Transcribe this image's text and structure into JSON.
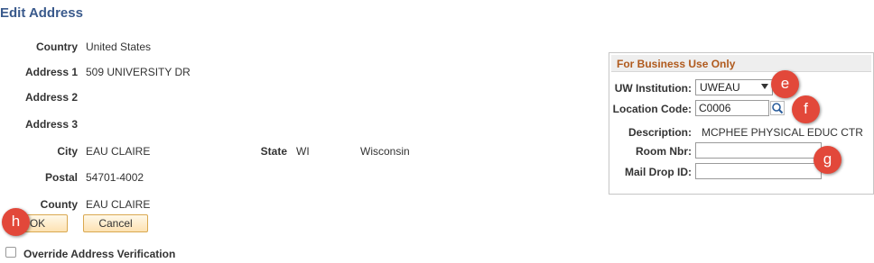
{
  "page": {
    "title": "Edit Address"
  },
  "address": {
    "country_label": "Country",
    "country_value": "United States",
    "address1_label": "Address 1",
    "address1_value": "509 UNIVERSITY DR",
    "address2_label": "Address 2",
    "address3_label": "Address 3",
    "city_label": "City",
    "city_value": "EAU CLAIRE",
    "state_label": "State",
    "state_code": "WI",
    "state_name": "Wisconsin",
    "postal_label": "Postal",
    "postal_value": "54701-4002",
    "county_label": "County",
    "county_value": "EAU CLAIRE"
  },
  "buttons": {
    "ok_label": "OK",
    "cancel_label": "Cancel"
  },
  "override": {
    "label": "Override Address Verification"
  },
  "business": {
    "title": "For Business Use Only",
    "institution_label": "UW Institution:",
    "institution_value": "UWEAU",
    "location_label": "Location Code:",
    "location_value": "C0006",
    "description_label": "Description:",
    "description_value": "MCPHEE PHYSICAL EDUC CTR",
    "room_label": "Room Nbr:",
    "room_value": "",
    "maildrop_label": "Mail Drop ID:",
    "maildrop_value": ""
  },
  "markers": {
    "e": "e",
    "f": "f",
    "g": "g",
    "h": "h"
  },
  "icons": {
    "lookup": "magnifier-icon",
    "dropdown": "chevron-down-icon",
    "checkbox": "checkbox-icon"
  },
  "colors": {
    "title": "#3a5a8c",
    "panel_title": "#b05a1d",
    "button_border": "#d9a84f",
    "marker": "#e2483a"
  }
}
